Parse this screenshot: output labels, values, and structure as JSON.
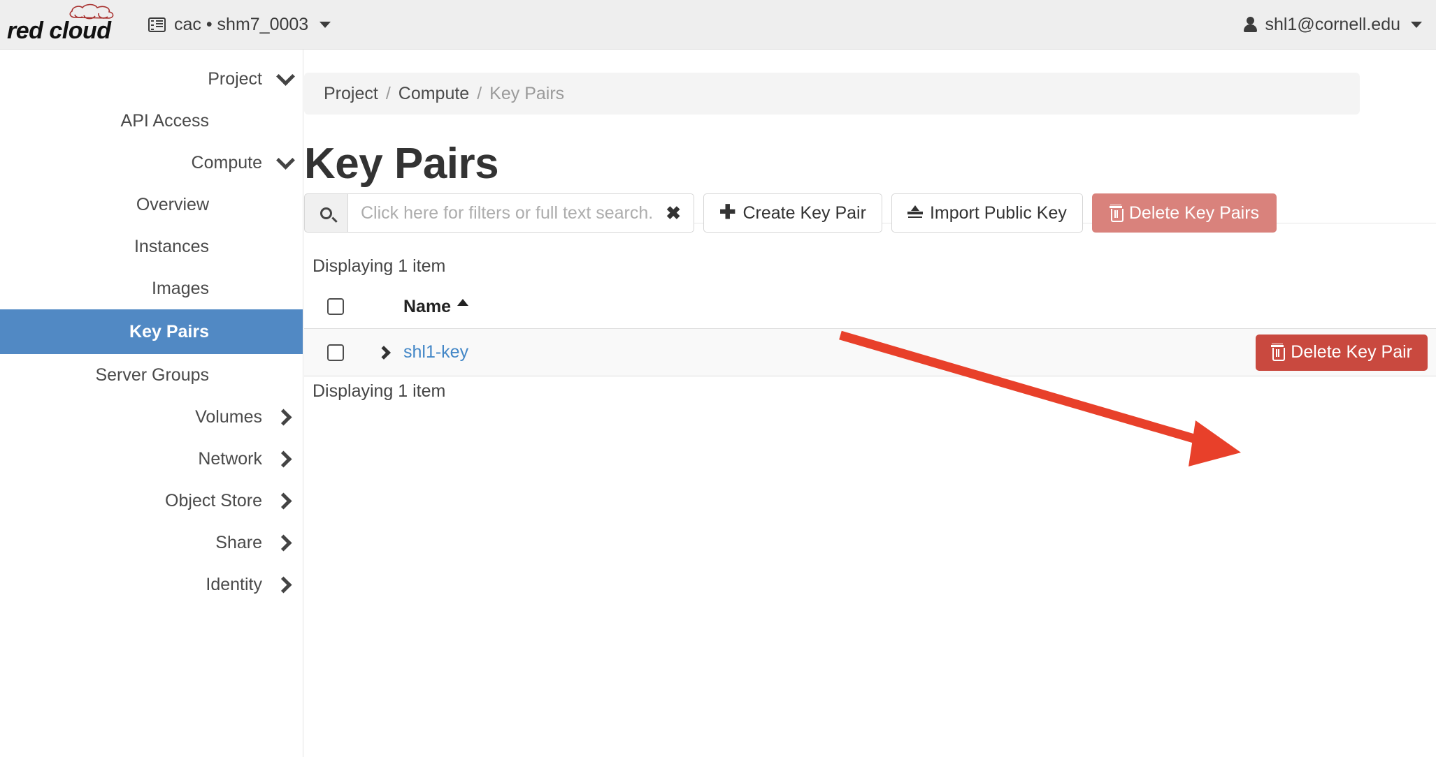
{
  "brand": {
    "logo_text": "red cloud",
    "logo_accent_color": "#a8312f"
  },
  "topbar": {
    "project_icon": "list-icon",
    "project_label": "cac • shm7_0003",
    "project_caret": "chevron-down-icon",
    "user_icon": "person-icon",
    "user_label": "shl1@cornell.edu",
    "user_caret": "chevron-down-icon",
    "background_color": "#eeeeee"
  },
  "sidebar": {
    "active_color": "#5189c4",
    "items": [
      {
        "label": "Project",
        "level": 0,
        "chevron": "chevron-down-icon",
        "active": false
      },
      {
        "label": "API Access",
        "level": 2,
        "chevron": "none",
        "active": false
      },
      {
        "label": "Compute",
        "level": 1,
        "chevron": "chevron-down-icon",
        "active": false
      },
      {
        "label": "Overview",
        "level": 2,
        "chevron": "none",
        "active": false
      },
      {
        "label": "Instances",
        "level": 2,
        "chevron": "none",
        "active": false
      },
      {
        "label": "Images",
        "level": 2,
        "chevron": "none",
        "active": false
      },
      {
        "label": "Key Pairs",
        "level": 2,
        "chevron": "none",
        "active": true
      },
      {
        "label": "Server Groups",
        "level": 2,
        "chevron": "none",
        "active": false
      },
      {
        "label": "Volumes",
        "level": 1,
        "chevron": "chevron-right-icon",
        "active": false
      },
      {
        "label": "Network",
        "level": 1,
        "chevron": "chevron-right-icon",
        "active": false
      },
      {
        "label": "Object Store",
        "level": 1,
        "chevron": "chevron-right-icon",
        "active": false
      },
      {
        "label": "Share",
        "level": 1,
        "chevron": "chevron-right-icon",
        "active": false
      },
      {
        "label": "Identity",
        "level": 0,
        "chevron": "chevron-right-icon",
        "active": false
      }
    ]
  },
  "breadcrumb": {
    "items": [
      "Project",
      "Compute",
      "Key Pairs"
    ],
    "separator": "/"
  },
  "page": {
    "title": "Key Pairs"
  },
  "search": {
    "icon": "search-icon",
    "placeholder": "Click here for filters or full text search.",
    "value": "",
    "clear_glyph": "✖"
  },
  "toolbar": {
    "create_label": "Create Key Pair",
    "create_icon": "plus-icon",
    "import_label": "Import Public Key",
    "import_icon": "upload-icon",
    "delete_label": "Delete Key Pairs",
    "delete_icon": "trash-icon",
    "delete_color": "#d9827c"
  },
  "table": {
    "count_top": "Displaying 1 item",
    "count_bottom": "Displaying 1 item",
    "columns": [
      "Name"
    ],
    "sort_column": "Name",
    "sort_direction": "asc",
    "rows": [
      {
        "selected": false,
        "expanded": false,
        "name": "shl1-key",
        "action_label": "Delete Key Pair",
        "action_icon": "trash-icon",
        "action_color": "#c9493f"
      }
    ]
  },
  "annotation": {
    "type": "arrow",
    "color": "#e8402a",
    "points_to": "Delete Key Pair"
  }
}
